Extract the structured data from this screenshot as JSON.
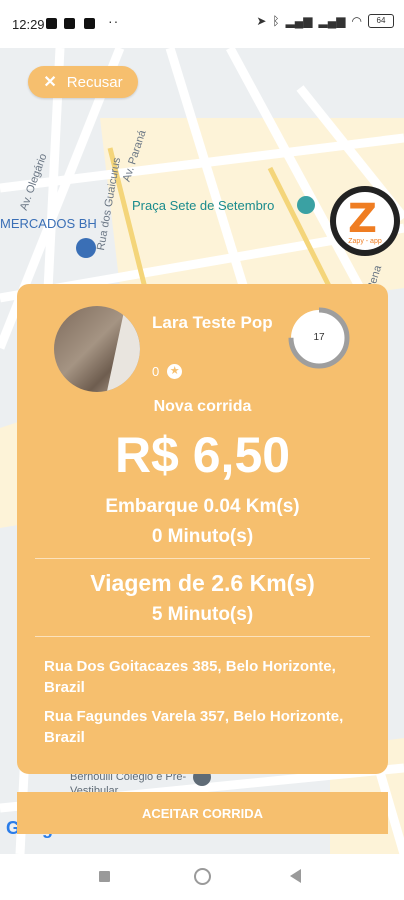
{
  "status_bar": {
    "time": "12:29",
    "dots": "··",
    "battery": "64"
  },
  "map": {
    "labels": {
      "av_parana": "Av. Paraná",
      "rua_guaicurus": "Rua dos Guaicurus",
      "av_olegario": "Av. Olegário",
      "praca": "Praça Sete de Setembro",
      "mercados": "MERCADOS BH",
      "av_afonso": "Av. Afonso Pena",
      "colegio": "Bernoulli Colégio e Pré-Vestibular",
      "google": "Google"
    }
  },
  "recusar": {
    "label": "Recusar"
  },
  "logo": {
    "letter": "Z",
    "text": "Zapy - app"
  },
  "request": {
    "passenger_name": "Lara Teste Pop",
    "rating": "0",
    "timer": "17",
    "timer_progress": 0.75,
    "title": "Nova corrida",
    "price": "R$ 6,50",
    "pickup_distance": "Embarque 0.04 Km(s)",
    "pickup_time": "0 Minuto(s)",
    "trip_distance": "Viagem de  2.6 Km(s)",
    "trip_time": "5 Minuto(s)",
    "origin": "Rua Dos Goitacazes 385, Belo Horizonte, Brazil",
    "destination": "Rua Fagundes Varela 357, Belo Horizonte, Brazil"
  },
  "accept": {
    "label": "ACEITAR CORRIDA"
  },
  "colors": {
    "accent": "#f6bf6e",
    "text_on_accent": "#ffffff"
  }
}
